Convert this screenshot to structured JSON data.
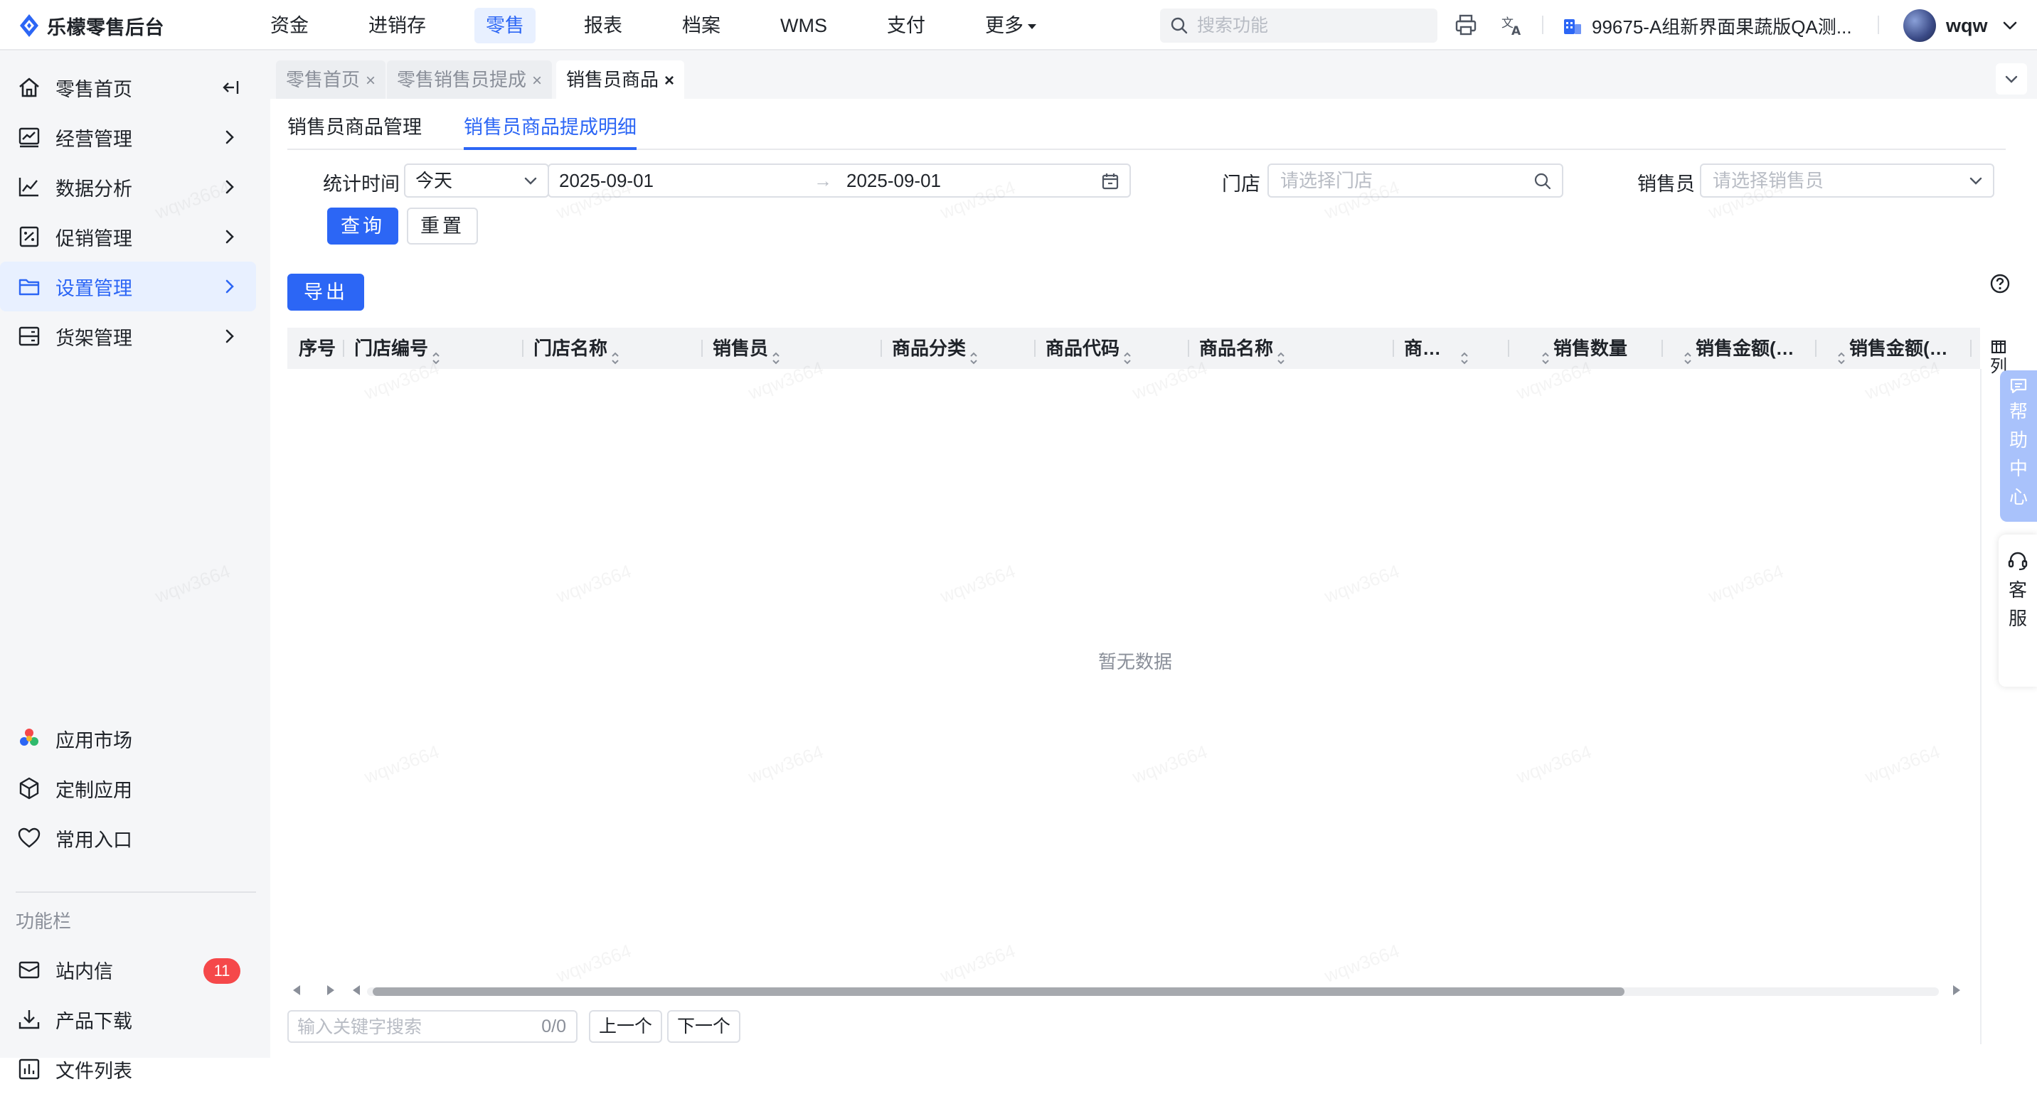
{
  "app": {
    "title": "乐檬零售后台"
  },
  "topnav": {
    "items": [
      "资金",
      "进销存",
      "零售",
      "报表",
      "档案",
      "WMS",
      "支付",
      "更多"
    ],
    "active_index": 2
  },
  "header": {
    "search_placeholder": "搜索功能",
    "org_name": "99675-A组新界面果蔬版QA测...",
    "user_name": "wqw"
  },
  "sidebar": {
    "items": [
      {
        "label": "零售首页",
        "icon": "home-icon"
      },
      {
        "label": "经营管理",
        "icon": "chart-window-icon"
      },
      {
        "label": "数据分析",
        "icon": "line-chart-icon"
      },
      {
        "label": "促销管理",
        "icon": "promotion-icon"
      },
      {
        "label": "设置管理",
        "icon": "folder-icon"
      },
      {
        "label": "货架管理",
        "icon": "shelf-icon"
      }
    ],
    "active_index": 4,
    "bottom_items": [
      {
        "label": "应用市场",
        "icon": "app-market-icon"
      },
      {
        "label": "定制应用",
        "icon": "cube-icon"
      },
      {
        "label": "常用入口",
        "icon": "heart-icon"
      }
    ],
    "section_title": "功能栏",
    "func_items": [
      {
        "label": "站内信",
        "icon": "mail-icon",
        "badge": "11"
      },
      {
        "label": "产品下载",
        "icon": "download-icon"
      },
      {
        "label": "文件列表",
        "icon": "file-list-icon"
      }
    ]
  },
  "page_tabs": [
    {
      "label": "零售首页",
      "close": "×"
    },
    {
      "label": "零售销售员提成",
      "close": "×"
    },
    {
      "label": "销售员商品",
      "close": "×"
    }
  ],
  "sub_tabs": [
    "销售员商品管理",
    "销售员商品提成明细"
  ],
  "filters": {
    "time_label": "统计时间",
    "time_preset": "今天",
    "date_start": "2025-09-01",
    "date_sep": "→",
    "date_end": "2025-09-01",
    "store_label": "门店",
    "store_placeholder": "请选择门店",
    "seller_label": "销售员",
    "seller_placeholder": "请选择销售员",
    "query_btn": "查询",
    "reset_btn": "重置"
  },
  "toolbar": {
    "export_btn": "导出"
  },
  "table": {
    "columns": [
      "序号",
      "门店编号",
      "门店名称",
      "销售员",
      "商品分类",
      "商品代码",
      "商品名称",
      "商…",
      "销售数量",
      "销售金额(…",
      "销售金额(…"
    ],
    "column_setting": "列",
    "empty_text": "暂无数据"
  },
  "pager": {
    "keyword_placeholder": "输入关键字搜索",
    "count": "0/0",
    "prev": "上一个",
    "next": "下一个"
  },
  "float": {
    "help": [
      "帮",
      "助",
      "中",
      "心"
    ],
    "service": [
      "客",
      "服"
    ]
  },
  "watermark": "wqw3664",
  "colors": {
    "accent": "#2c66f5",
    "active_bg": "#e8f0ff",
    "badge": "#f5484a"
  }
}
